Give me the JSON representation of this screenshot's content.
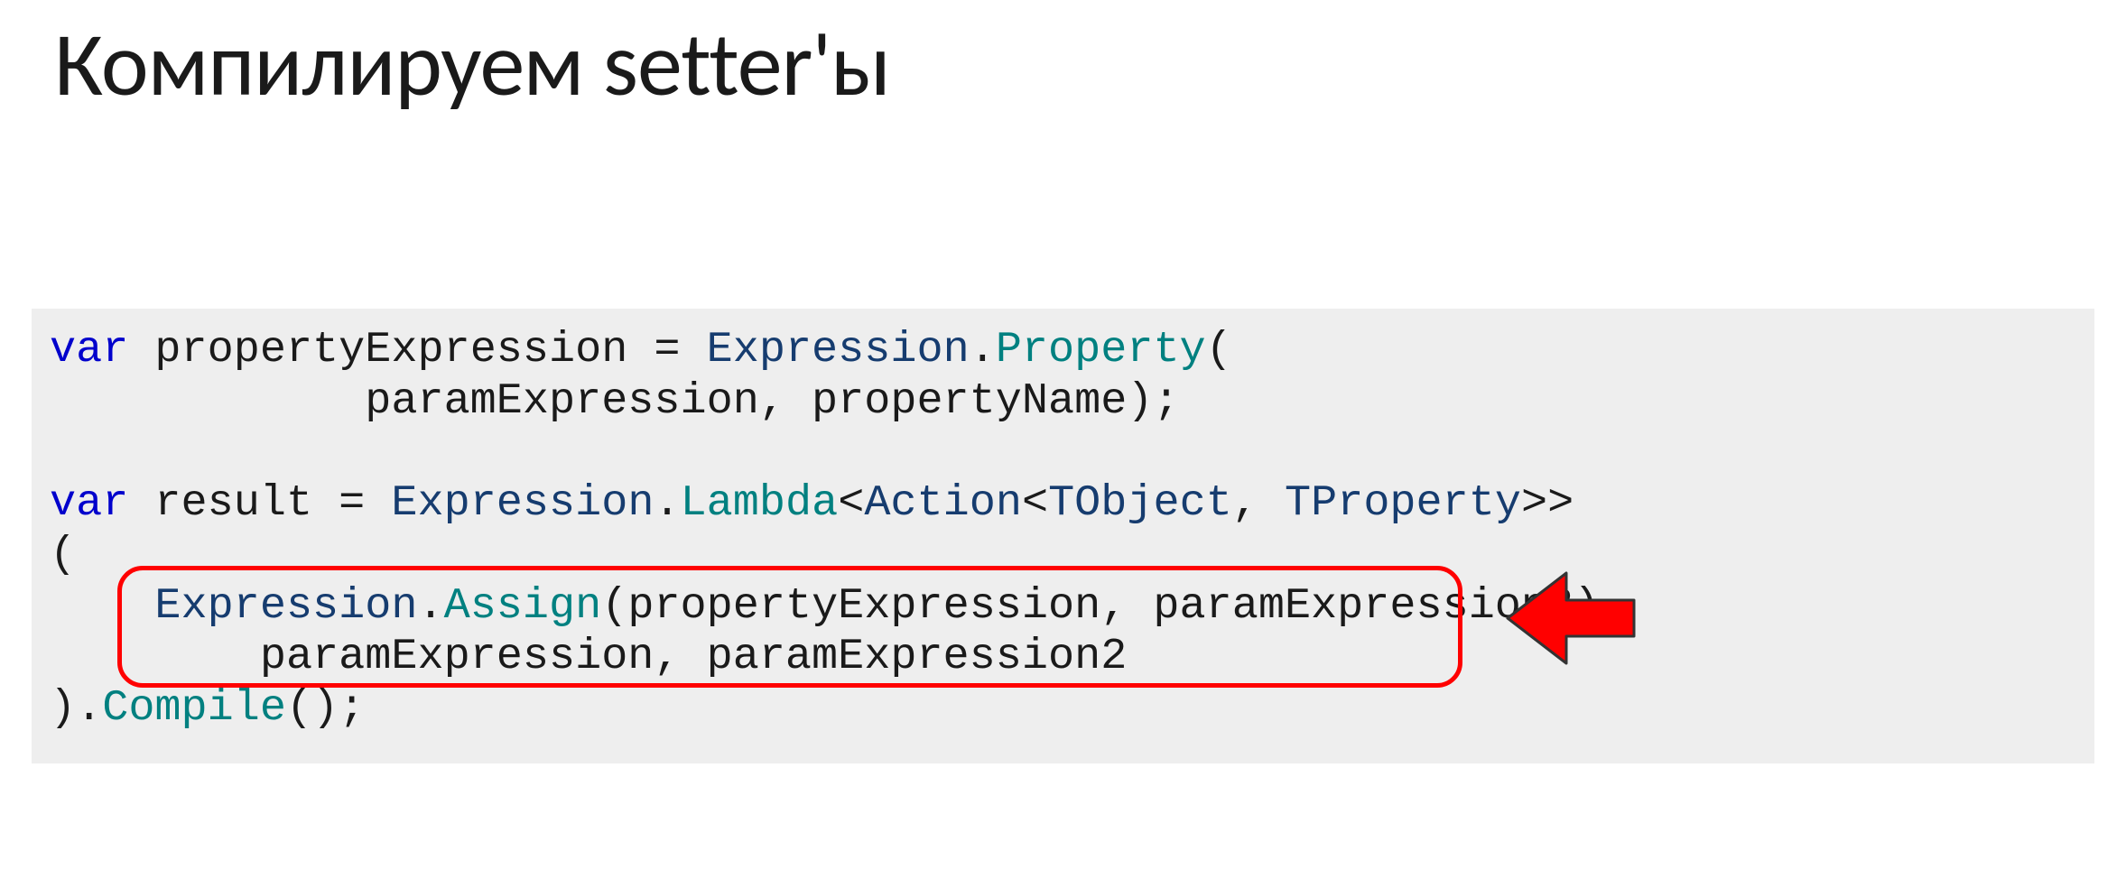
{
  "title": "Компилируем setter'ы",
  "code": {
    "line1": {
      "kw": "var",
      "t1": " propertyExpression = ",
      "type1": "Expression",
      "dot1": ".",
      "meth1": "Property",
      "t2": "("
    },
    "line2": "            paramExpression, propertyName);",
    "line3": "",
    "line4": {
      "kw": "var",
      "t1": " result = ",
      "type1": "Expression",
      "dot1": ".",
      "meth1": "Lambda",
      "t2": "<",
      "type2": "Action",
      "t3": "<",
      "type3": "TObject",
      "t4": ", ",
      "type4": "TProperty",
      "t5": ">>"
    },
    "line5": "(",
    "line6": {
      "t1": "    ",
      "type1": "Expression",
      "dot1": ".",
      "meth1": "Assign",
      "t2": "(propertyExpression, paramExpression2),"
    },
    "line7": "        paramExpression, paramExpression2",
    "line8": {
      "t1": ").",
      "meth1": "Compile",
      "t2": "();"
    }
  }
}
